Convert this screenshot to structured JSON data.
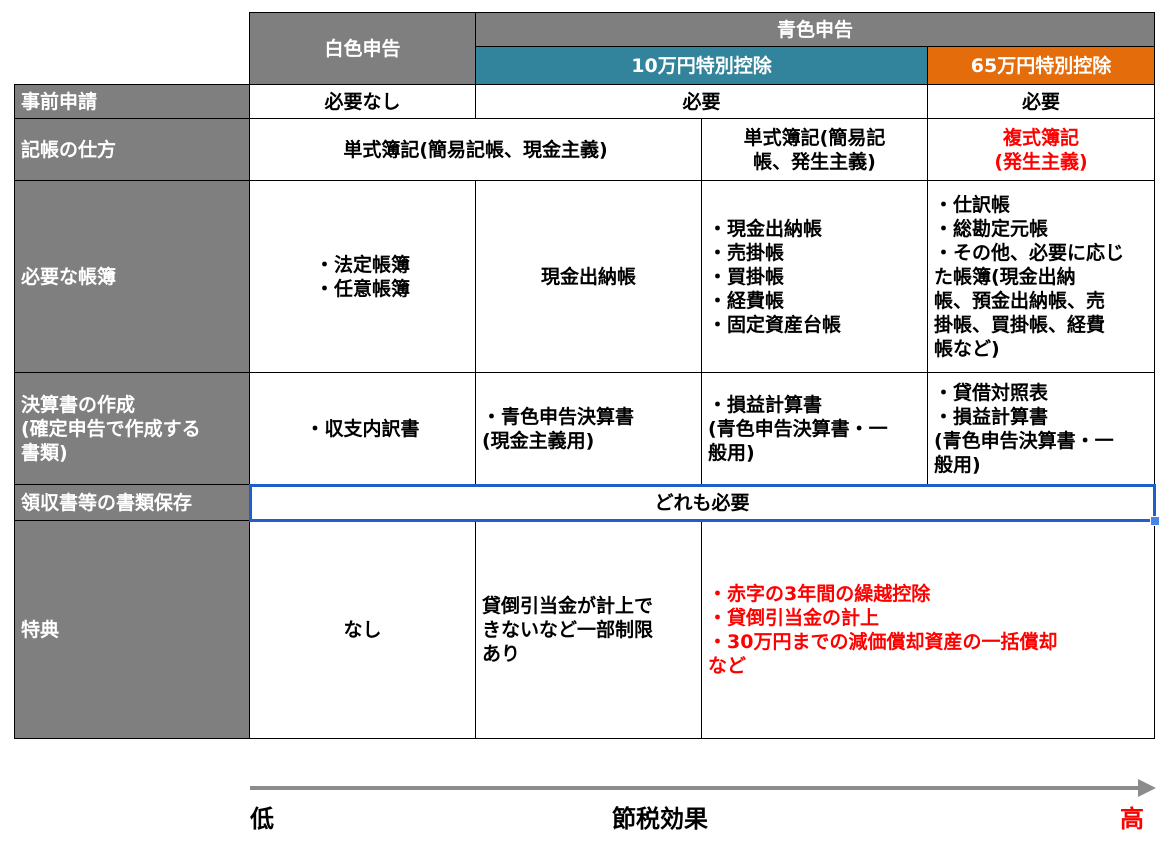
{
  "header": {
    "white": "白色申告",
    "blue": "青色申告",
    "blue10": "10万円特別控除",
    "blue65": "65万円特別控除"
  },
  "colors": {
    "gray": "#7f7f7f",
    "teal": "#31849b",
    "orange": "#e46c0a",
    "red": "#ff0000",
    "selection": "#1f5fc9",
    "arrow": "#8c8c8c"
  },
  "rows": {
    "application": {
      "label": "事前申請",
      "white": "必要なし",
      "blue10": "必要",
      "blue65": "必要"
    },
    "bookkeeping": {
      "label": "記帳の仕方",
      "white_blue": "単式簿記(簡易記帳、現金主義)",
      "blue10b": [
        "単式簿記(簡易記",
        "帳、発生主義)"
      ],
      "blue65": [
        "複式簿記",
        "(発生主義)"
      ]
    },
    "ledgers": {
      "label": "必要な帳簿",
      "white": [
        "・法定帳簿",
        "・任意帳簿"
      ],
      "blue10a": "現金出納帳",
      "blue10b": [
        "・現金出納帳",
        "・売掛帳",
        "・買掛帳",
        "・経費帳",
        "・固定資産台帳"
      ],
      "blue65": [
        "・仕訳帳",
        "・総勘定元帳",
        "・その他、必要に応じ",
        "た帳簿(現金出納",
        "帳、預金出納帳、売",
        "掛帳、買掛帳、経費",
        "帳など)"
      ]
    },
    "statements": {
      "label": [
        "決算書の作成",
        "(確定申告で作成する",
        "書類)"
      ],
      "white": "・収支内訳書",
      "blue10a": [
        "・青色申告決算書",
        "(現金主義用)"
      ],
      "blue10b": [
        "・損益計算書",
        "(青色申告決算書・一",
        "般用)"
      ],
      "blue65": [
        "・貸借対照表",
        "・損益計算書",
        "(青色申告決算書・一",
        "般用)"
      ]
    },
    "receipts": {
      "label": "領収書等の書類保存",
      "all": "どれも必要"
    },
    "benefits": {
      "label": "特典",
      "white": "なし",
      "blue10a": [
        "貸倒引当金が計上で",
        "きないなど一部制限",
        "あり"
      ],
      "blue_rest": [
        "・赤字の3年間の繰越控除",
        "・貸倒引当金の計上",
        "・30万円までの減価償却資産の一括償却",
        "など"
      ]
    }
  },
  "axis": {
    "low": "低",
    "title": "節税効果",
    "high": "高"
  }
}
